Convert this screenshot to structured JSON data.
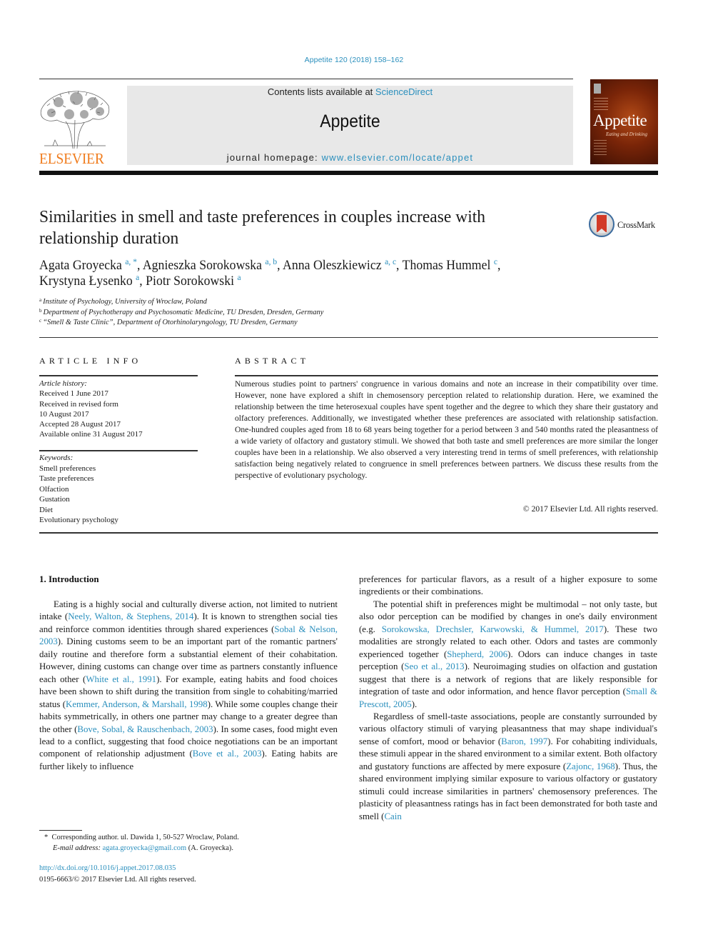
{
  "journal_ref": "Appetite 120 (2018) 158–162",
  "masthead": {
    "contents_prefix": "Contents lists available at ",
    "contents_link": "ScienceDirect",
    "journal_title": "Appetite",
    "homepage_prefix": "journal homepage: ",
    "homepage_link": "www.elsevier.com/locate/appet"
  },
  "publisher_logo": {
    "icon": "elsevier-tree-icon",
    "wordmark": "ELSEVIER",
    "color": "#f07c1d"
  },
  "cover": {
    "title": "Appetite",
    "subtitle": "Eating and Drinking"
  },
  "crossmark": {
    "icon": "crossmark-icon",
    "label": "CrossMark"
  },
  "article": {
    "title": "Similarities in smell and taste preferences in couples increase with relationship duration",
    "authors": [
      {
        "name": "Agata Groyecka",
        "affil": "a, *",
        "sep": ", "
      },
      {
        "name": "Agnieszka Sorokowska",
        "affil": "a, b",
        "sep": ", "
      },
      {
        "name": "Anna Oleszkiewicz",
        "affil": "a, c",
        "sep": ", "
      },
      {
        "name": "Thomas Hummel",
        "affil": "c",
        "sep": ","
      },
      {
        "name": "Krystyna Łysenko",
        "affil": "a",
        "sep": ", "
      },
      {
        "name": "Piotr Sorokowski",
        "affil": "a",
        "sep": ""
      }
    ],
    "affiliations": [
      {
        "mark": "a",
        "text": "Institute of Psychology, University of Wroclaw, Poland"
      },
      {
        "mark": "b",
        "text": "Department of Psychotherapy and Psychosomatic Medicine, TU Dresden, Dresden, Germany"
      },
      {
        "mark": "c",
        "text": "“Smell & Taste Clinic”, Department of Otorhinolaryngology, TU Dresden, Germany"
      }
    ]
  },
  "article_info": {
    "heading": "ARTICLE INFO",
    "history_label": "Article history:",
    "history": [
      "Received 1 June 2017",
      "Received in revised form",
      "10 August 2017",
      "Accepted 28 August 2017",
      "Available online 31 August 2017"
    ],
    "keywords_label": "Keywords:",
    "keywords": [
      "Smell preferences",
      "Taste preferences",
      "Olfaction",
      "Gustation",
      "Diet",
      "Evolutionary psychology"
    ]
  },
  "abstract": {
    "heading": "ABSTRACT",
    "text": "Numerous studies point to partners' congruence in various domains and note an increase in their compatibility over time. However, none have explored a shift in chemosensory perception related to relationship duration. Here, we examined the relationship between the time heterosexual couples have spent together and the degree to which they share their gustatory and olfactory preferences. Addi­tionally, we investigated whether these preferences are associated with relationship satisfaction. One-hundred couples aged from 18 to 68 years being together for a period between 3 and 540 months rated the pleasantness of a wide variety of olfactory and gustatory stimuli. We showed that both taste and smell preferences are more similar the longer couples have been in a relationship. We also observed a very interesting trend in terms of smell preferences, with relationship satisfaction being negatively related to congruence in smell preferences between partners. We discuss these results from the perspective of evolutionary psychology.",
    "copyright": "© 2017 Elsevier Ltd. All rights reserved."
  },
  "introduction": {
    "heading": "1.  Introduction",
    "left_paragraph": [
      {
        "t": "Eating is a highly social and culturally diverse action, not limited to nutrient intake ("
      },
      {
        "c": "Neely, Walton, & Stephens, 2014"
      },
      {
        "t": "). It is known to strengthen social ties and reinforce common identities through shared experiences ("
      },
      {
        "c": "Sobal & Nelson, 2003"
      },
      {
        "t": "). Dining customs seem to be an important part of the romantic partners' daily routine and therefore form a substantial element of their cohabitation. How­ever, dining customs can change over time as partners constantly influence each other ("
      },
      {
        "c": "White et al., 1991"
      },
      {
        "t": "). For example, eating habits and food choices have been shown to shift during the transition from single to cohabiting/married status ("
      },
      {
        "c": "Kemmer, Anderson, & Marshall, 1998"
      },
      {
        "t": "). While some couples change their habits symmet­rically, in others one partner may change to a greater degree than the other ("
      },
      {
        "c": "Bove, Sobal, & Rauschenbach, 2003"
      },
      {
        "t": "). In some cases, food might even lead to a conflict, suggesting that food choice negotia­tions can be an important component of relationship adjustment ("
      },
      {
        "c": "Bove et al., 2003"
      },
      {
        "t": "). Eating habits are further likely to influence"
      }
    ],
    "right_continuation": [
      {
        "t": "preferences for particular flavors, as a result of a higher exposure to some ingredients or their combinations."
      }
    ],
    "right_paragraph_2": [
      {
        "t": "The potential shift in preferences might be multimodal – not only taste, but also odor perception can be modified by changes in one's daily environment (e.g. "
      },
      {
        "c": "Sorokowska, Drechsler, Karwowski, & Hummel, 2017"
      },
      {
        "t": "). These two modalities are strongly related to each other. Odors and tastes are commonly experienced together ("
      },
      {
        "c": "Shepherd, 2006"
      },
      {
        "t": "). Odors can induce changes in taste perception ("
      },
      {
        "c": "Seo et al., 2013"
      },
      {
        "t": "). Neuroimaging studies on olfaction and gustation suggest that there is a network of regions that are likely responsible for integration of taste and odor information, and hence flavor perception ("
      },
      {
        "c": "Small & Prescott, 2005"
      },
      {
        "t": ")."
      }
    ],
    "right_paragraph_3": [
      {
        "t": "Regardless of smell-taste associations, people are constantly surrounded by various olfactory stimuli of varying pleasantness that may shape individual's sense of comfort, mood or behavior ("
      },
      {
        "c": "Baron, 1997"
      },
      {
        "t": "). For cohabiting individuals, these stimuli appear in the shared environment to a similar extent. Both olfactory and gustatory functions are affected by mere exposure ("
      },
      {
        "c": "Zajonc, 1968"
      },
      {
        "t": "). Thus, the shared environment implying similar exposure to various olfactory or gustatory stimuli could increase similarities in part­ners' chemosensory preferences. The plasticity of pleasantness ratings has in fact been demonstrated for both taste and smell ("
      },
      {
        "c": "Cain"
      }
    ]
  },
  "footnote": {
    "mark": "*",
    "corresponding": "Corresponding author. ul. Dawida 1, 50-527 Wroclaw, Poland.",
    "email_label": "E-mail address: ",
    "email": "agata.groyecka@gmail.com",
    "email_suffix": " (A. Groyecka)."
  },
  "doi": "http://dx.doi.org/10.1016/j.appet.2017.08.035",
  "issn_line": "0195-6663/© 2017 Elsevier Ltd. All rights reserved."
}
